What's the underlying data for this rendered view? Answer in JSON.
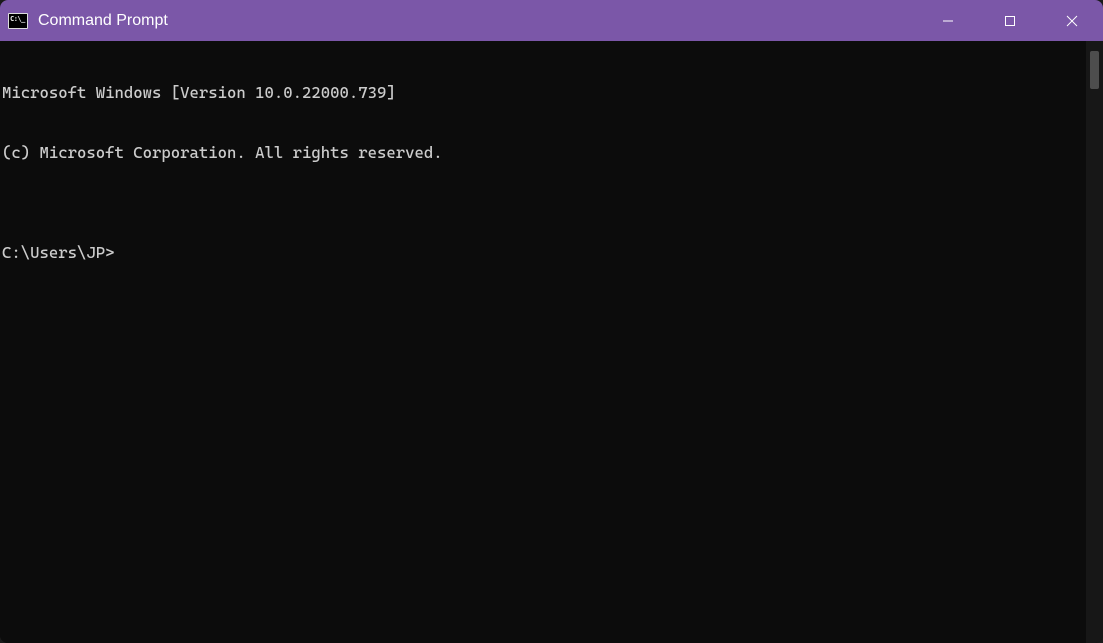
{
  "window": {
    "title": "Command Prompt"
  },
  "terminal": {
    "lines": [
      "Microsoft Windows [Version 10.0.22000.739]",
      "(c) Microsoft Corporation. All rights reserved.",
      "",
      "C:\\Users\\JP>"
    ]
  }
}
